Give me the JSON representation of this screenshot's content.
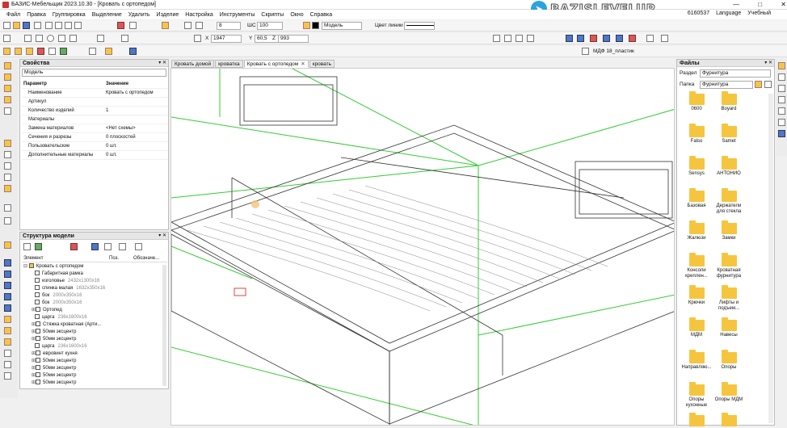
{
  "window": {
    "title": "БАЗИС-Мебельщик 2023.10.30 - [Кровать с ортопедом]",
    "controls": [
      "—",
      "□",
      "✕"
    ]
  },
  "watermark": {
    "text": "BAZISLEVELUP"
  },
  "menu": {
    "items": [
      "Файл",
      "Правка",
      "Группировка",
      "Выделение",
      "Удалить",
      "Изделие",
      "Настройка",
      "Инструменты",
      "Скрипты",
      "Окно",
      "Справка"
    ],
    "right": {
      "user_id": "6160537",
      "language": "Language",
      "mode": "Учебный"
    }
  },
  "toolbar": {
    "step": "8",
    "scale_label": "ШС",
    "scale_value": "100",
    "model_label": "Модель",
    "line_color_label": "Цвет линии",
    "material": "МДФ 18_пластик"
  },
  "coords": {
    "x_label": "X",
    "x": "1947",
    "y_label": "Y",
    "y": "60,5",
    "z_label": "Z",
    "z": "993"
  },
  "tabs": [
    {
      "label": "Кровать домой",
      "active": false
    },
    {
      "label": "кроватка",
      "active": false
    },
    {
      "label": "Кровать с ортопедом",
      "active": true,
      "close": "✕"
    },
    {
      "label": "кровать",
      "active": false
    }
  ],
  "properties": {
    "title": "Свойства",
    "selector": "Модель",
    "col_param": "Параметр",
    "col_value": "Значение",
    "rows": [
      {
        "k": "Наименование",
        "v": "Кровать с ортопедом"
      },
      {
        "k": "Артикул",
        "v": ""
      },
      {
        "k": "Количество изделий",
        "v": "1"
      },
      {
        "k": "Материалы",
        "v": ""
      },
      {
        "k": "Замена материалов",
        "v": "<Нет схемы>"
      },
      {
        "k": "Сечения и разрезы",
        "v": "0 плоскостей"
      },
      {
        "k": "Пользовательские",
        "v": "0 шт."
      },
      {
        "k": "Дополнительные материалы",
        "v": "0 шт."
      }
    ]
  },
  "structure": {
    "title": "Структура модели",
    "col_element": "Элемент",
    "col_pos": "Поз.",
    "col_desig": "Обозначе...",
    "items": [
      {
        "label": "Кровать с ортопедом",
        "dim": "",
        "level": 0
      },
      {
        "label": "Габаритная рамка",
        "dim": "",
        "level": 1
      },
      {
        "label": "изголовье",
        "dim": "2432x1300x16",
        "level": 1
      },
      {
        "label": "спинка малая",
        "dim": "1632x350x16",
        "level": 1
      },
      {
        "label": "бок",
        "dim": "2000x350x16",
        "level": 1
      },
      {
        "label": "бок",
        "dim": "2000x350x16",
        "level": 1
      },
      {
        "label": "Ортопед",
        "dim": "",
        "level": 1
      },
      {
        "label": "царга",
        "dim": "236x1600x16",
        "level": 1
      },
      {
        "label": "Стяжка кроватная (Арти...",
        "dim": "",
        "level": 1
      },
      {
        "label": "50мм эксцентр",
        "dim": "",
        "level": 1
      },
      {
        "label": "50мм эксцентр",
        "dim": "",
        "level": 1
      },
      {
        "label": "царга",
        "dim": "236x1600x16",
        "level": 1
      },
      {
        "label": "евровинт кухня",
        "dim": "",
        "level": 1
      },
      {
        "label": "50мм эксцентр",
        "dim": "",
        "level": 1
      },
      {
        "label": "50мм эксцентр",
        "dim": "",
        "level": 1
      },
      {
        "label": "50мм эксцентр",
        "dim": "",
        "level": 1
      },
      {
        "label": "50мм эксцентр",
        "dim": "",
        "level": 1
      }
    ]
  },
  "files": {
    "title": "Файлы",
    "section_label": "Раздел",
    "section_value": "Фурнитура",
    "folder_label": "Папка",
    "folder_value": "Фурнитура",
    "folders": [
      "0600",
      "Boyard",
      "Falso",
      "Samet",
      "Sensys",
      "АНТОНИО",
      "Базовая",
      "Держатели для стекла",
      "Жалюзи",
      "Замки",
      "Консоли креплен...",
      "Кроватная фурнитура",
      "Крючки",
      "Лифты и подъем...",
      "МДМ",
      "Навесы",
      "Направляю...",
      "Опоры",
      "Опоры кухонные",
      "Опоры МДМ",
      "",
      ""
    ]
  }
}
